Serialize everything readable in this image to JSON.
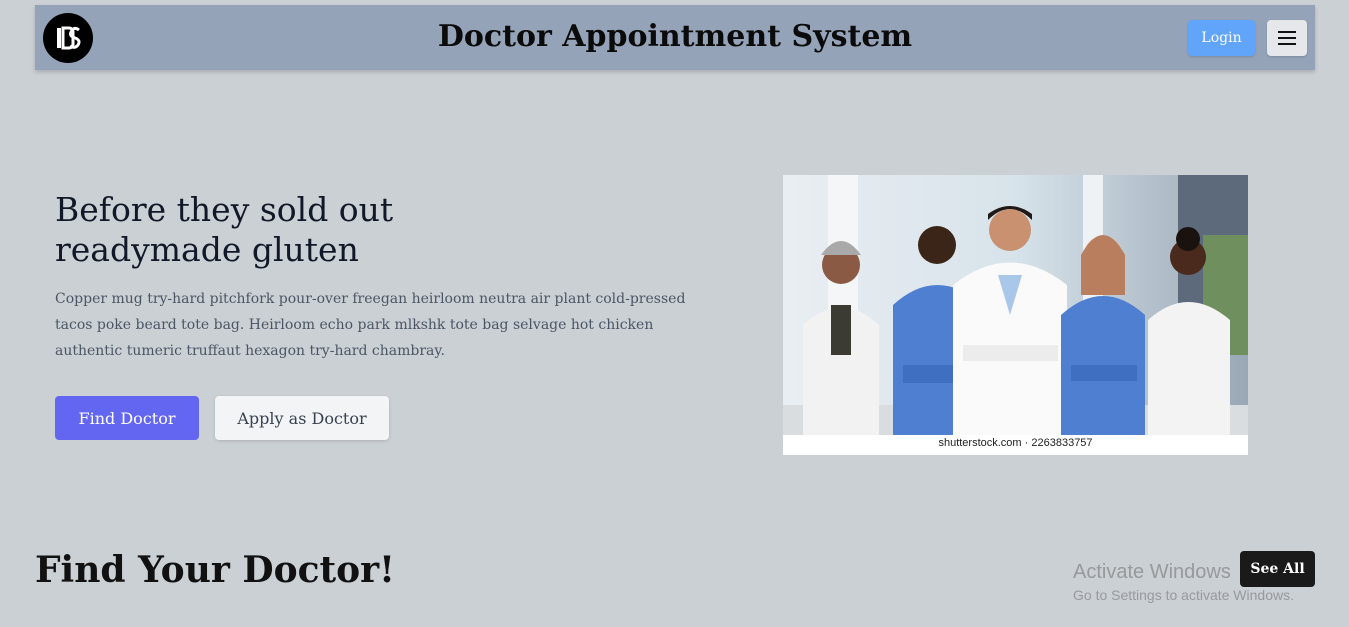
{
  "navbar": {
    "logo_text": "DAS",
    "title": "Doctor Appointment System",
    "login_label": "Login",
    "menu_icon": "hamburger-menu-icon"
  },
  "hero": {
    "heading_line1": "Before they sold out",
    "heading_line2": "readymade gluten",
    "description": "Copper mug try-hard pitchfork pour-over freegan heirloom neutra air plant cold-pressed tacos poke beard tote bag. Heirloom echo park mlkshk tote bag selvage hot chicken authentic tumeric truffaut hexagon try-hard chambray.",
    "primary_button": "Find Doctor",
    "secondary_button": "Apply as Doctor",
    "image_caption": "shutterstock.com · 2263833757"
  },
  "doctors_section": {
    "title": "Find Your Doctor!",
    "see_all_label": "See All"
  },
  "os_overlay": {
    "line1": "Activate Windows",
    "line2": "Go to Settings to activate Windows."
  },
  "colors": {
    "page_bg": "#cbd0d5",
    "navbar_bg": "#94a3b8",
    "login_bg": "#60a5fa",
    "primary_bg": "#6366f1",
    "see_all_bg": "#1a1a1a"
  }
}
